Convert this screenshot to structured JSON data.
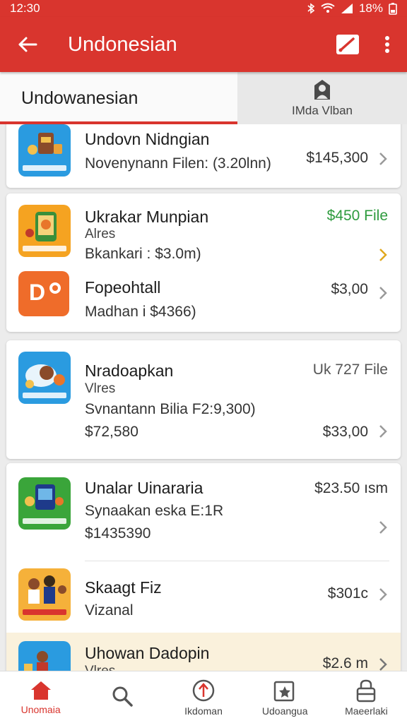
{
  "status_bar": {
    "time": "12:30",
    "battery": "18%"
  },
  "app_bar": {
    "title": "Undonesian",
    "icons": [
      "back-arrow-icon",
      "edit-icon",
      "more-vert-icon"
    ]
  },
  "tabs": [
    {
      "label": "Undowanesian",
      "active": true
    },
    {
      "label": "IMda Vlban",
      "active": false,
      "icon": "person-icon"
    }
  ],
  "list": [
    {
      "name": "Undovn Nidngian",
      "detail": "Novenynann Filen: (3.20lnn)",
      "price": "$145,300",
      "color": "#2a9be0"
    },
    {
      "name": "Ukrakar Munpian",
      "subtitle": "Alres",
      "detail": "Bkankari : $3.0m)",
      "price": "$450 File",
      "price_color": "#2e9b3e",
      "color": "#f5a321"
    },
    {
      "name": "Fopeohtall",
      "detail": "Madhan i $4366)",
      "price": "$3,00",
      "color": "#ef6c2a",
      "icon_text": "D"
    },
    {
      "name": "Nradoapkan",
      "subtitle": "Vlres",
      "detail": "Svnantann Bilia F2:9,300)",
      "detail2": "$72,580",
      "price": "Uk 727 File",
      "price2": "$33,00",
      "color": "#2a9be0"
    },
    {
      "name": "Unalar Uinararia",
      "detail": "Synaakan eska E:1R",
      "detail2": "$1435390",
      "price": "$23.50 ısm",
      "color": "#3aa53a"
    },
    {
      "name": "Skaagt Fiz",
      "detail": "Vizanal",
      "price": "$301c",
      "color": "#f5b13a"
    },
    {
      "name": "Uhowan Dadopin",
      "subtitle": "Vlres",
      "price": "$2.6 m",
      "color": "#2a9be0"
    }
  ],
  "bottom_nav": [
    {
      "label": "Unomaia",
      "icon": "home-icon",
      "active": true
    },
    {
      "label": "",
      "icon": "search-icon",
      "active": false
    },
    {
      "label": "Ikdoman",
      "icon": "compass-icon",
      "active": false
    },
    {
      "label": "Udoangua",
      "icon": "star-box-icon",
      "active": false
    },
    {
      "label": "Maeerlaki",
      "icon": "lock-icon",
      "active": false
    }
  ]
}
